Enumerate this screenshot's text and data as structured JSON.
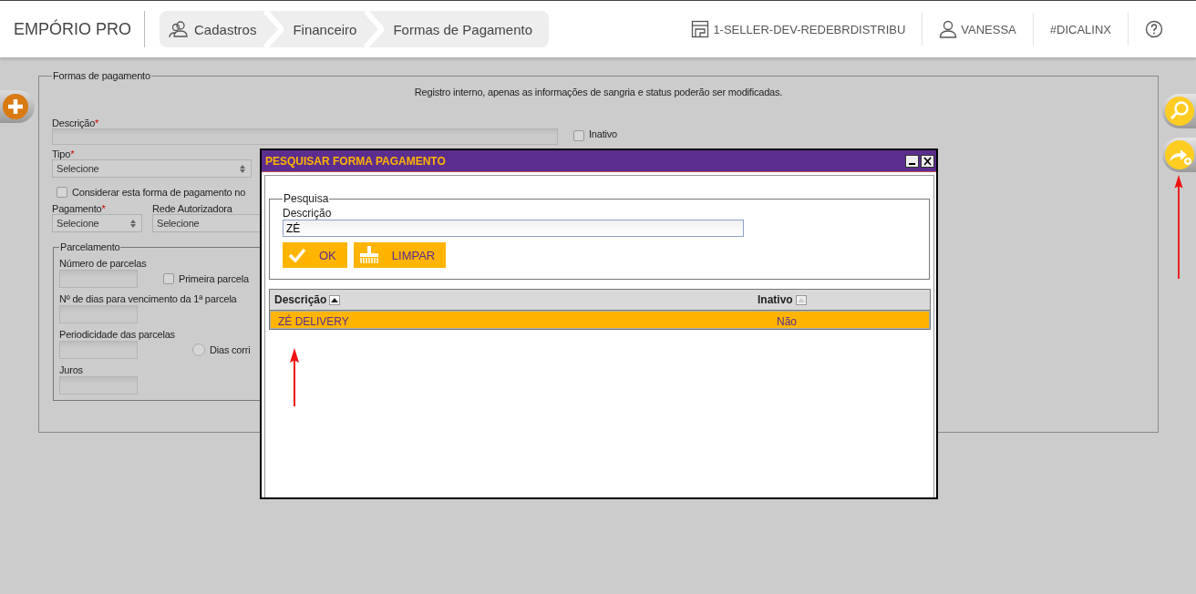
{
  "app": {
    "title": "EMPÓRIO PRO"
  },
  "breadcrumb": [
    {
      "label": "Cadastros"
    },
    {
      "label": "Financeiro"
    },
    {
      "label": "Formas de Pagamento"
    }
  ],
  "topbar": {
    "store": "1-SELLER-DEV-REDEBRDISTRIBU",
    "user": "VANESSA",
    "tag": "#DICALINX"
  },
  "form": {
    "legend": "Formas de pagamento",
    "notice": "Registro interno, apenas as informações de sangria e status poderão ser modificadas.",
    "description": {
      "label": "Descrição",
      "mark": "*"
    },
    "inactive": {
      "label": "Inativo",
      "checked": false
    },
    "type": {
      "label": "Tipo",
      "mark": "*",
      "value": "Selecione"
    },
    "consider": {
      "label": "Considerar esta forma de pagamento no",
      "checked": false
    },
    "payment": {
      "label": "Pagamento",
      "mark": "*",
      "value": "Selecione"
    },
    "network": {
      "label": "Rede Autorizadora",
      "value": "Selecione"
    },
    "installments": {
      "legend": "Parcelamento",
      "count_label": "Número de parcelas",
      "first": {
        "label": "Primeira parcela",
        "checked": false
      },
      "days_label": "Nº de dias para vencimento da 1ª parcela",
      "period_label": "Periodicidade das parcelas",
      "calendar": {
        "label": "Dias corri",
        "selected": false
      },
      "interest_label": "Juros"
    }
  },
  "dialog": {
    "title": "PESQUISAR FORMA PAGAMENTO",
    "search": {
      "legend": "Pesquisa",
      "label": "Descrição",
      "value": "ZÉ"
    },
    "buttons": [
      {
        "label": "OK",
        "kind": "ok"
      },
      {
        "label": "LIMPAR",
        "kind": "clear"
      }
    ],
    "table": {
      "columns": [
        {
          "label": "Descrição",
          "sorted": true
        },
        {
          "label": "Inativo",
          "sorted": false
        }
      ],
      "rows": [
        {
          "cells": [
            "ZÉ DELIVERY",
            "Não"
          ],
          "selected": true
        }
      ]
    }
  }
}
